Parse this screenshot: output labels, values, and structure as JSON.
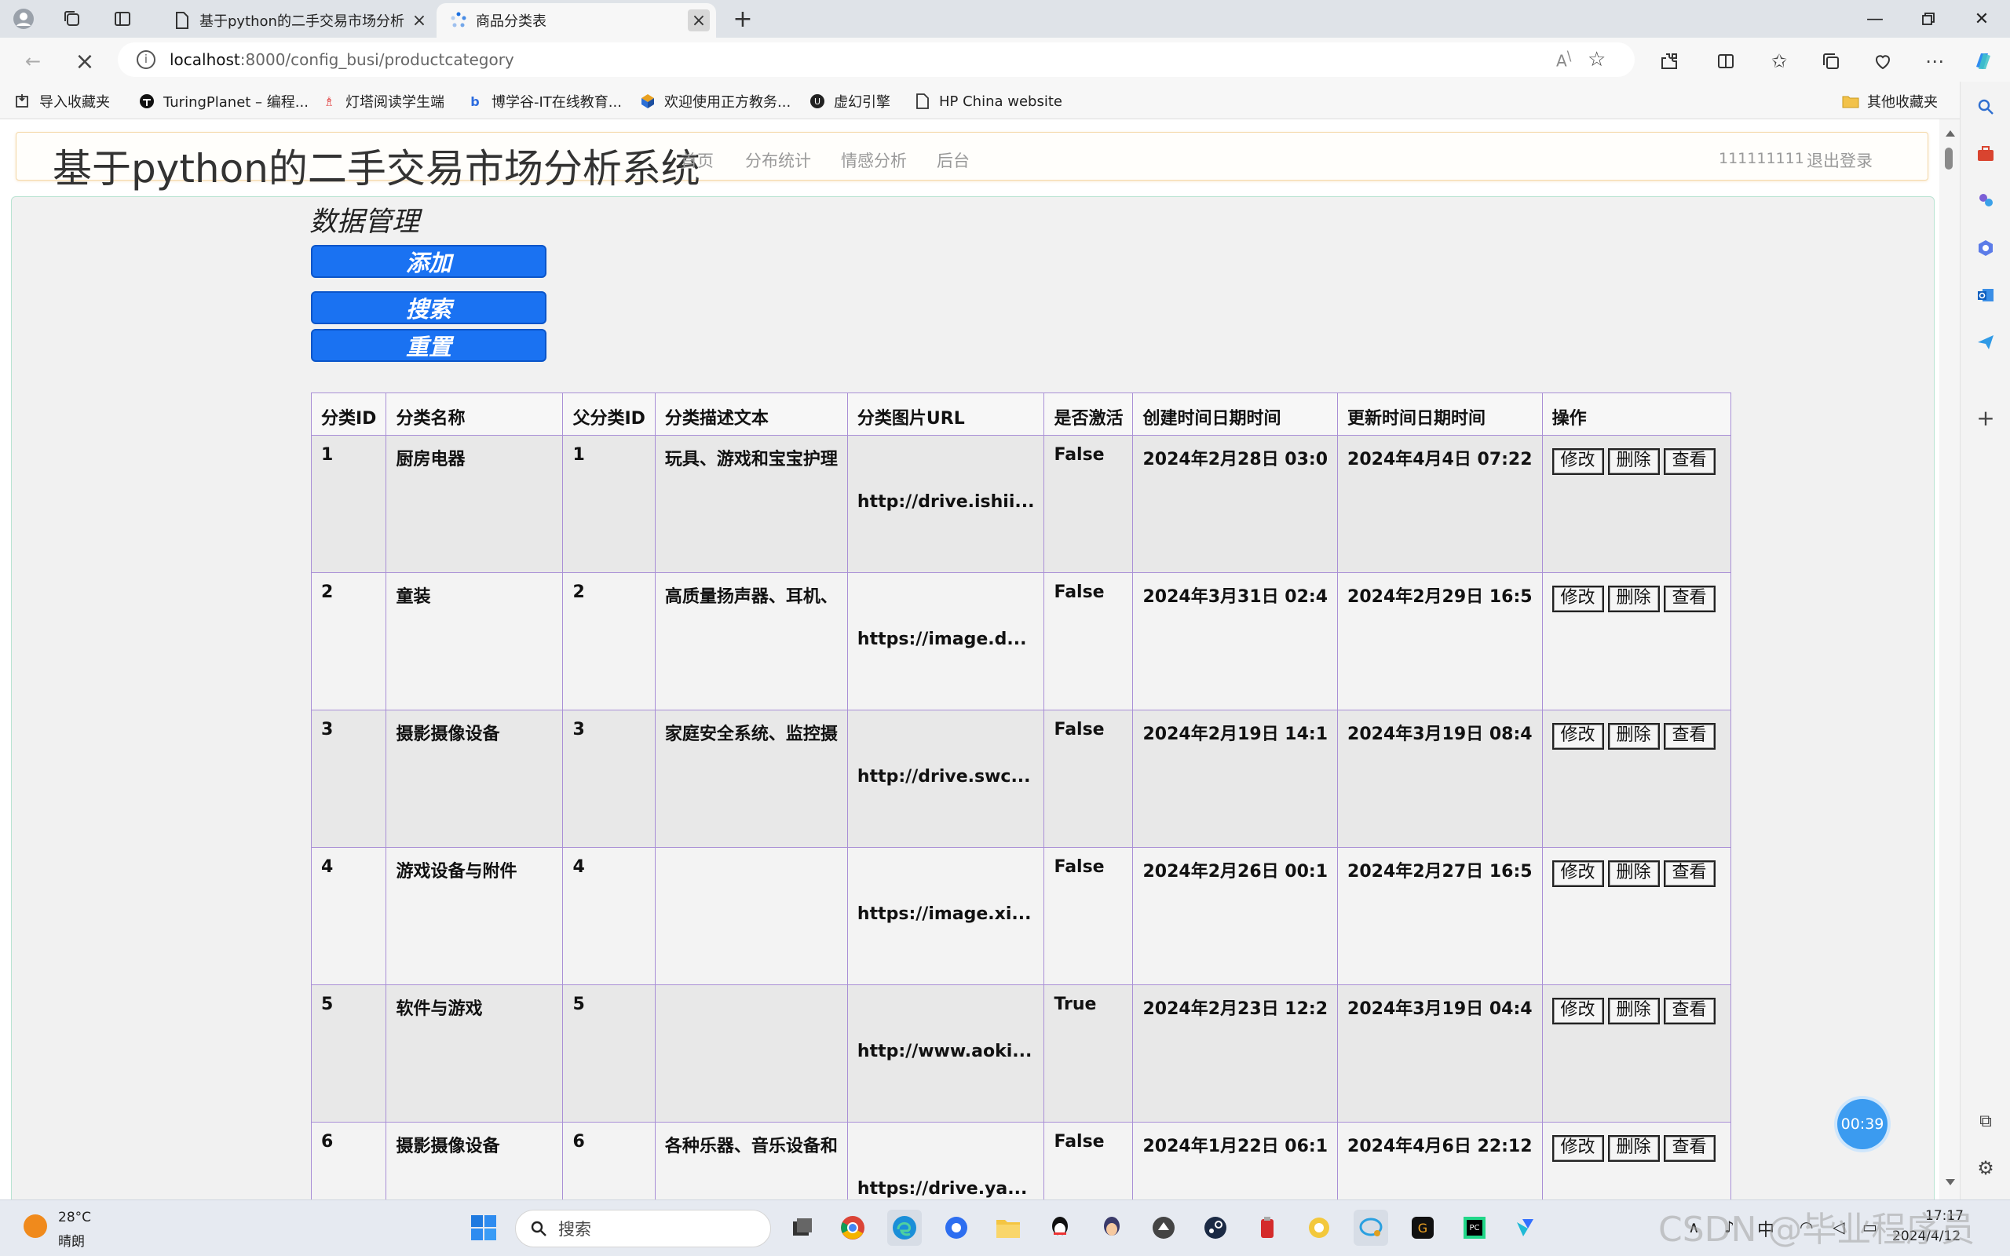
{
  "browser": {
    "tabs": [
      {
        "title": "基于python的二手交易市场分析"
      },
      {
        "title": "商品分类表"
      }
    ],
    "url_host": "localhost",
    "url_path": ":8000/config_busi/productcategory",
    "bookmarks": [
      {
        "label": "导入收藏夹"
      },
      {
        "label": "TuringPlanet – 编程..."
      },
      {
        "label": "灯塔阅读学生端"
      },
      {
        "label": "博学谷-IT在线教育..."
      },
      {
        "label": "欢迎使用正方教务..."
      },
      {
        "label": "虚幻引擎"
      },
      {
        "label": "HP China website"
      }
    ],
    "other_bookmarks": "其他收藏夹"
  },
  "site": {
    "title": "基于python的二手交易市场分析系统",
    "nav": [
      "首页",
      "分布统计",
      "情感分析",
      "后台"
    ],
    "user": "111111111",
    "logout": "退出登录"
  },
  "main": {
    "section_title": "数据管理",
    "add_label": "添加",
    "search_label": "搜索",
    "reset_label": "重置"
  },
  "table": {
    "headers": [
      "分类ID",
      "分类名称",
      "父分类ID",
      "分类描述文本",
      "分类图片URL",
      "是否激活",
      "创建时间日期时间",
      "更新时间日期时间",
      "操作"
    ],
    "op_labels": {
      "edit": "修改",
      "delete": "删除",
      "view": "查看"
    },
    "rows": [
      {
        "id": "1",
        "name": "厨房电器",
        "parent": "1",
        "desc": "玩具、游戏和宝宝护理",
        "url": "http://drive.ishii...",
        "active": "False",
        "created": "2024年2月28日 03:0",
        "updated": "2024年4月4日 07:22"
      },
      {
        "id": "2",
        "name": "童装",
        "parent": "2",
        "desc": "高质量扬声器、耳机、",
        "url": "https://image.d...",
        "active": "False",
        "created": "2024年3月31日 02:4",
        "updated": "2024年2月29日 16:5"
      },
      {
        "id": "3",
        "name": "摄影摄像设备",
        "parent": "3",
        "desc": "家庭安全系统、监控摄",
        "url": "http://drive.swc...",
        "active": "False",
        "created": "2024年2月19日 14:1",
        "updated": "2024年3月19日 08:4"
      },
      {
        "id": "4",
        "name": "游戏设备与附件",
        "parent": "4",
        "desc": "",
        "url": "https://image.xi...",
        "active": "False",
        "created": "2024年2月26日 00:1",
        "updated": "2024年2月27日 16:5"
      },
      {
        "id": "5",
        "name": "软件与游戏",
        "parent": "5",
        "desc": "",
        "url": "http://www.aoki...",
        "active": "True",
        "created": "2024年2月23日 12:2",
        "updated": "2024年3月19日 04:4"
      },
      {
        "id": "6",
        "name": "摄影摄像设备",
        "parent": "6",
        "desc": "各种乐器、音乐设备和",
        "url": "https://drive.ya...",
        "active": "False",
        "created": "2024年1月22日 06:1",
        "updated": "2024年4月6日 22:12"
      }
    ]
  },
  "timer": "00:39",
  "taskbar": {
    "temp": "28°C",
    "weather": "晴朗",
    "search_placeholder": "搜索",
    "ime": "中",
    "time": "17:17",
    "date": "2024/4/12"
  },
  "watermark": "CSDN @毕业程序员"
}
